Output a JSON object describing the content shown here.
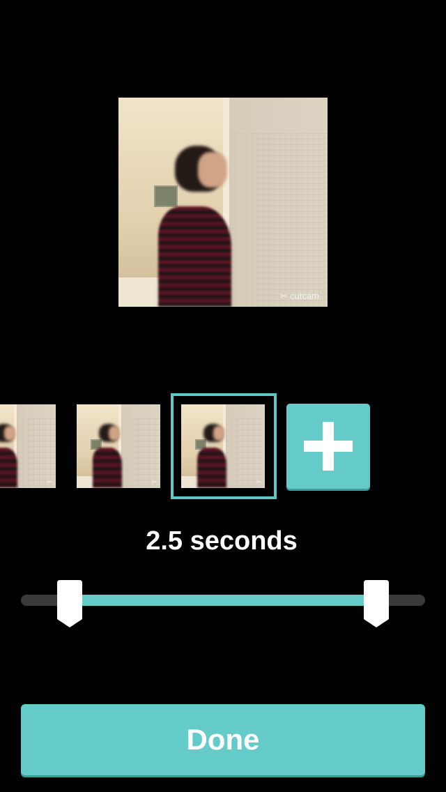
{
  "preview": {
    "watermark": "✂ cutcam"
  },
  "thumbnails": [
    {
      "watermark": "✂"
    },
    {
      "watermark": "✂"
    },
    {
      "watermark": "✂"
    }
  ],
  "add_clip": {
    "icon": "plus-icon"
  },
  "duration": {
    "label": "2.5 seconds"
  },
  "trim": {
    "start_fraction": 0.12,
    "end_fraction": 0.88
  },
  "done_button": {
    "label": "Done"
  },
  "colors": {
    "accent": "#64cbc9",
    "background": "#000000",
    "track": "#3a3a3a"
  }
}
